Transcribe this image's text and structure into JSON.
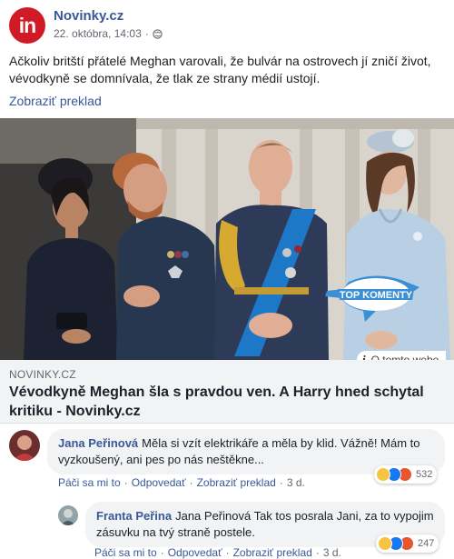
{
  "post": {
    "page_name": "Novinky.cz",
    "avatar_text": "in",
    "timestamp": "22. októbra, 14:03",
    "text": "Ačkoliv britští přátelé Meghan varovali, že bulvár na ostrovech jí zničí život, vévodkyně se domnívala, že tlak ze strany médií ustojí.",
    "translate_label": "Zobraziť preklad"
  },
  "image": {
    "badge_text": "TOP KOMENTY",
    "about_label": "O tomto webe"
  },
  "link": {
    "domain": "NOVINKY.CZ",
    "title": "Vévodkyně Meghan šla s pravdou ven. A Harry hned schytal kritiku - Novinky.cz"
  },
  "comments": [
    {
      "author": "Jana Peřinová",
      "text": "Měla si vzít elektrikáře a měla by klid. Vážně! Mám to vyzkoušený, ani pes po nás neštěkne...",
      "like_label": "Páči sa mi to",
      "reply_label": "Odpovedať",
      "translate_label": "Zobraziť preklad",
      "time": "3 d.",
      "reaction_count": "532"
    },
    {
      "author": "Franta Peřina",
      "text": "Jana Peřinová Tak tos posrala Jani, za to vypojim zásuvku na tvý straně postele.",
      "like_label": "Páči sa mi to",
      "reply_label": "Odpovedať",
      "translate_label": "Zobraziť preklad",
      "time": "3 d.",
      "reaction_count": "247"
    }
  ],
  "colors": {
    "link_blue": "#385898",
    "brand_red": "#d01b27",
    "badge_blue": "#3b8fd6"
  }
}
